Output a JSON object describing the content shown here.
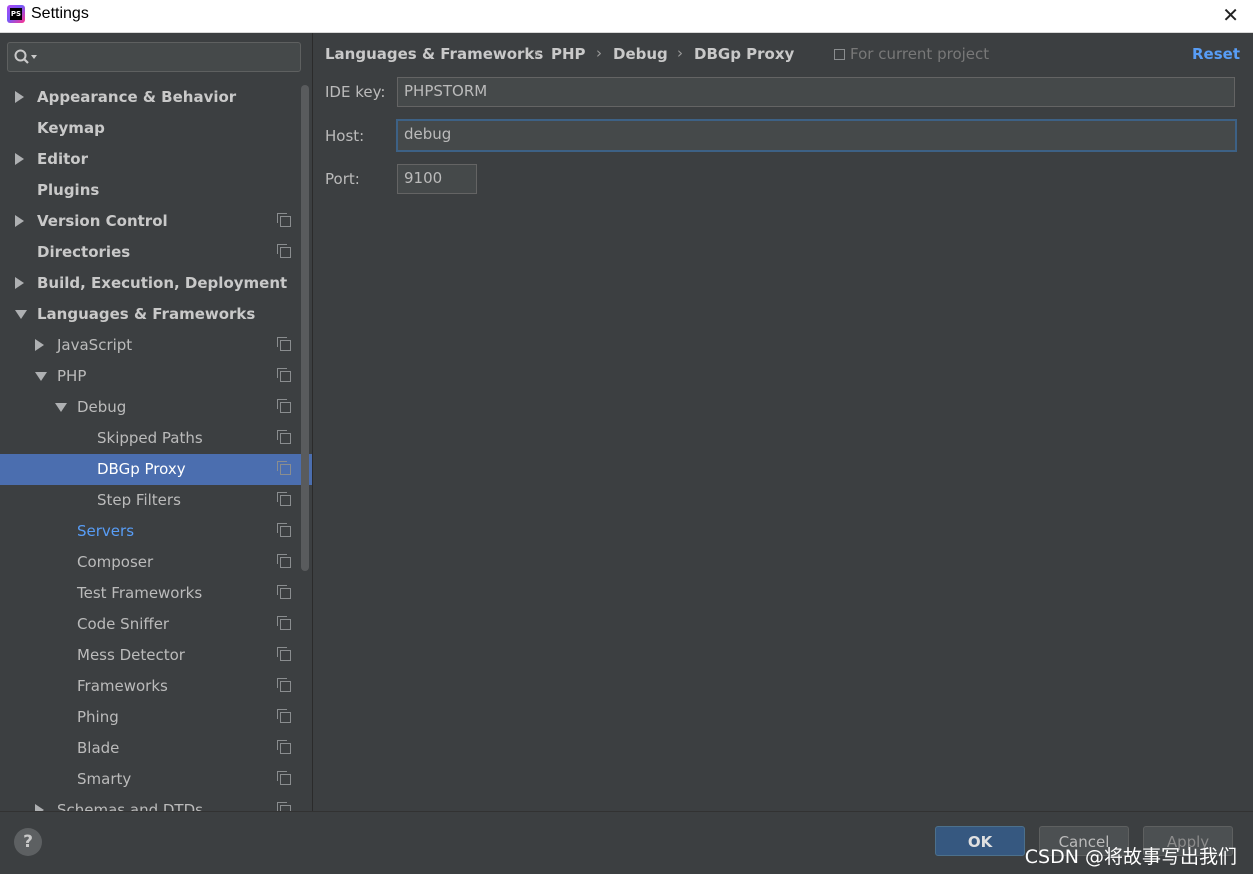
{
  "window": {
    "title": "Settings",
    "app_icon_text": "PS"
  },
  "search": {
    "placeholder": ""
  },
  "tree": [
    {
      "label": "Appearance & Behavior",
      "bold": true,
      "arrow": "right",
      "indent": 0,
      "project_icon": false
    },
    {
      "label": "Keymap",
      "bold": true,
      "arrow": "none",
      "indent": 0,
      "project_icon": false
    },
    {
      "label": "Editor",
      "bold": true,
      "arrow": "right",
      "indent": 0,
      "project_icon": false
    },
    {
      "label": "Plugins",
      "bold": true,
      "arrow": "none",
      "indent": 0,
      "project_icon": false
    },
    {
      "label": "Version Control",
      "bold": true,
      "arrow": "right",
      "indent": 0,
      "project_icon": true
    },
    {
      "label": "Directories",
      "bold": true,
      "arrow": "none",
      "indent": 0,
      "project_icon": true
    },
    {
      "label": "Build, Execution, Deployment",
      "bold": true,
      "arrow": "right",
      "indent": 0,
      "project_icon": false
    },
    {
      "label": "Languages & Frameworks",
      "bold": true,
      "arrow": "down",
      "indent": 0,
      "project_icon": false
    },
    {
      "label": "JavaScript",
      "bold": false,
      "arrow": "right",
      "indent": 1,
      "project_icon": true
    },
    {
      "label": "PHP",
      "bold": false,
      "arrow": "down",
      "indent": 1,
      "project_icon": true
    },
    {
      "label": "Debug",
      "bold": false,
      "arrow": "down",
      "indent": 2,
      "project_icon": true
    },
    {
      "label": "Skipped Paths",
      "bold": false,
      "arrow": "none",
      "indent": 3,
      "project_icon": true
    },
    {
      "label": "DBGp Proxy",
      "bold": false,
      "arrow": "none",
      "indent": 3,
      "project_icon": true,
      "selected": true
    },
    {
      "label": "Step Filters",
      "bold": false,
      "arrow": "none",
      "indent": 3,
      "project_icon": true
    },
    {
      "label": "Servers",
      "bold": false,
      "arrow": "none",
      "indent": 2,
      "project_icon": true,
      "link": true
    },
    {
      "label": "Composer",
      "bold": false,
      "arrow": "none",
      "indent": 2,
      "project_icon": true
    },
    {
      "label": "Test Frameworks",
      "bold": false,
      "arrow": "none",
      "indent": 2,
      "project_icon": true
    },
    {
      "label": "Code Sniffer",
      "bold": false,
      "arrow": "none",
      "indent": 2,
      "project_icon": true
    },
    {
      "label": "Mess Detector",
      "bold": false,
      "arrow": "none",
      "indent": 2,
      "project_icon": true
    },
    {
      "label": "Frameworks",
      "bold": false,
      "arrow": "none",
      "indent": 2,
      "project_icon": true
    },
    {
      "label": "Phing",
      "bold": false,
      "arrow": "none",
      "indent": 2,
      "project_icon": true
    },
    {
      "label": "Blade",
      "bold": false,
      "arrow": "none",
      "indent": 2,
      "project_icon": true
    },
    {
      "label": "Smarty",
      "bold": false,
      "arrow": "none",
      "indent": 2,
      "project_icon": true
    },
    {
      "label": "Schemas and DTDs",
      "bold": false,
      "arrow": "right",
      "indent": 1,
      "project_icon": true
    }
  ],
  "breadcrumb": {
    "items": [
      "Languages & Frameworks",
      "PHP",
      "Debug",
      "DBGp Proxy"
    ],
    "separator": "›"
  },
  "scope": {
    "text": "For current project"
  },
  "reset_label": "Reset",
  "form": {
    "ide_key": {
      "label": "IDE key:",
      "value": "PHPSTORM"
    },
    "host": {
      "label": "Host:",
      "value": "debug"
    },
    "port": {
      "label": "Port:",
      "value": "9100"
    }
  },
  "footer": {
    "help_label": "?",
    "ok_label": "OK",
    "cancel_label": "Cancel",
    "apply_label": "Apply",
    "watermark": "CSDN @将故事写出我们"
  },
  "colors": {
    "accent": "#589df6",
    "selection": "#4b6eaf",
    "background": "#3c3f41"
  }
}
